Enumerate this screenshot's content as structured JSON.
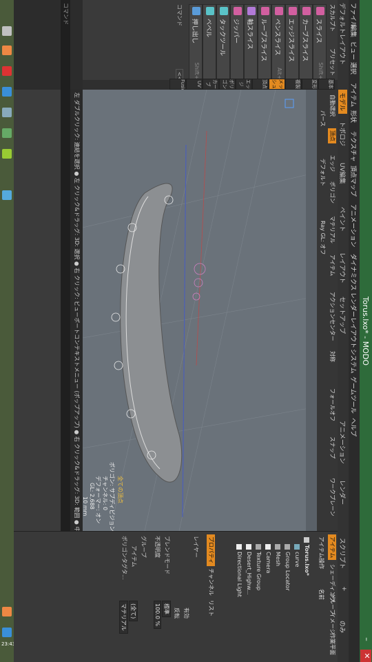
{
  "taskbar": {
    "clock": "23:43"
  },
  "window": {
    "title": "Torus.lxo* - MODO"
  },
  "menubar": {
    "items": [
      "ファイル",
      "編集",
      "ビュー",
      "選択",
      "アイテム",
      "形状",
      "テクスチャ",
      "頂点マップ",
      "アニメーション",
      "ダイナミクス",
      "レンダー",
      "レイアウト",
      "システム",
      "ゲームツール",
      "ヘルプ"
    ]
  },
  "layoutbar": {
    "preset": "デフォルトレイアウト",
    "tabs": [
      "モデル",
      "トポロジ",
      "UV編集",
      "ペイント",
      "レイアウト",
      "セットアップ",
      "アニメーション",
      "レンダー",
      "スクリプト"
    ],
    "plus": "+",
    "only": "のみ"
  },
  "leftpanel": {
    "sculpt_label": "スカルプト",
    "preset_label": "プリセット",
    "tools": [
      {
        "label": "スライス",
        "shortcut": "Shift+C"
      },
      {
        "label": "カーブスライス",
        "shortcut": ""
      },
      {
        "label": "エッジスライス",
        "shortcut": "C"
      },
      {
        "label": "ペンスライス",
        "shortcut": "Alt+C"
      },
      {
        "label": "ループスライス",
        "shortcut": ""
      },
      {
        "label": "軸スライス",
        "shortcut": ""
      },
      {
        "label": "ジッパー",
        "shortcut": ""
      },
      {
        "label": "タックツール",
        "shortcut": ""
      },
      {
        "label": "ベベル",
        "shortcut": "B"
      },
      {
        "label": "押し出し",
        "shortcut": "Shift+X"
      }
    ],
    "vertical_tabs": [
      "基本",
      "変形",
      "複製",
      "メッシュ",
      "頂点",
      "エッジ",
      "ポリゴン",
      "カーブ",
      "UV",
      "Fusion"
    ],
    "commands_label": "コマンド",
    "collapse": "<<"
  },
  "modebar": {
    "modes": [
      "自動選択",
      "頂点",
      "エッジ",
      "ポリゴン",
      "マテリアル",
      "アイテム",
      "アクションセンター",
      "対称",
      "フォールオフ",
      "スナップ",
      "ワークプレーン"
    ],
    "active_mode": "頂点",
    "sub": [
      "パース",
      "デフォルト",
      "Ray GL: オフ"
    ]
  },
  "viewport": {
    "info": [
      "全ての頂点",
      "ポリゴン: サブディビジョン",
      "チャンネル: 0",
      "デフォーマー: オン",
      "GL: 2,688",
      "10 mm"
    ]
  },
  "status": {
    "text": "左 ダブルクリック: 連結を選択 ● 左 クリック&ドラッグ: 3D: 選択 ● 右 クリック: ビューポートコンテキストメニュー (ポップアップ) ● 右 クリック&ドラッグ: 3D: 範囲 ● 中 クリック..."
  },
  "command": {
    "label": "コマンド"
  },
  "rightpanel": {
    "tabs": [
      "アイテム",
      "シェーディング",
      "グループ",
      "イメージ",
      "作業平面"
    ],
    "active_tab": "アイテム",
    "subtabs": [
      "アイテム操作",
      "名前"
    ],
    "tree": [
      {
        "name": "Torus.lxo*"
      },
      {
        "name": "curve"
      },
      {
        "name": "Group Locator"
      },
      {
        "name": "Mesh"
      },
      {
        "name": "Camera"
      },
      {
        "name": "Texture Group"
      },
      {
        "name": "Desert_Highw..."
      },
      {
        "name": "Directional Light"
      }
    ],
    "prop_tabs": [
      "プロパティ",
      "チャンネル",
      "リスト"
    ],
    "layer_label": "レイヤー",
    "enabled_label": "有効",
    "invert_label": "反転",
    "blend_label": "ブレンドモード",
    "blend_value": "標準",
    "opacity_label": "不透明度",
    "opacity_value": "100.0 %",
    "group_label": "グループ",
    "item_label": "アイテム",
    "item_value": "(全て)",
    "polytag_label": "ポリゴンタグタ...",
    "polytag_value": "マテリアル"
  }
}
